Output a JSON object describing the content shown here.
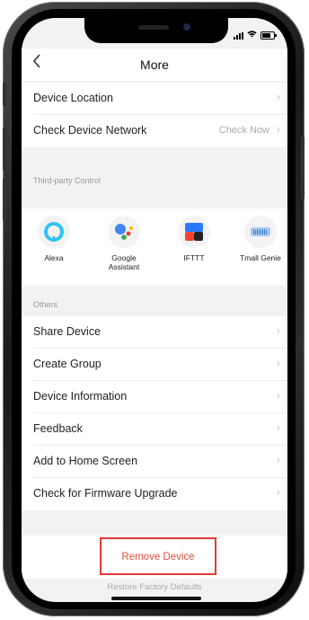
{
  "nav": {
    "title": "More",
    "back_icon": "chevron-left-icon"
  },
  "status": {
    "signal": "signal-icon",
    "wifi": "wifi-icon",
    "battery": "battery-icon"
  },
  "settings": {
    "device_location": "Device Location",
    "check_network": "Check Device Network",
    "check_now": "Check Now"
  },
  "third_party": {
    "header": "Third-party Control",
    "items": [
      {
        "label": "Alexa",
        "icon": "alexa-icon"
      },
      {
        "label": "Google\nAssistant",
        "icon": "google-assistant-icon"
      },
      {
        "label": "IFTTT",
        "icon": "ifttt-icon"
      },
      {
        "label": "Tmall Genie",
        "icon": "tmall-genie-icon"
      }
    ]
  },
  "others": {
    "header": "Others",
    "items": [
      "Share Device",
      "Create Group",
      "Device Information",
      "Feedback",
      "Add to Home Screen",
      "Check for Firmware Upgrade"
    ]
  },
  "actions": {
    "remove": "Remove Device",
    "restore": "Restore Factory Defaults"
  },
  "colors": {
    "accent_red": "#e53935",
    "background": "#f2f2f2",
    "alexa_blue": "#31c4f3",
    "ifttt_blue": "#2979ff"
  }
}
